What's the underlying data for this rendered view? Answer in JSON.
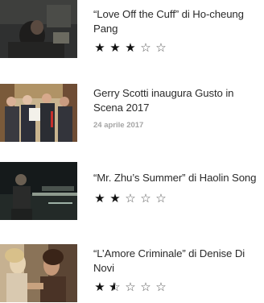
{
  "items": [
    {
      "title": "“Love Off the Cuff” di Ho-cheung Pang",
      "rating": 3,
      "max_rating": 5,
      "thumb_icon": "movie-still-dark-room"
    },
    {
      "title": "Gerry Scotti inaugura Gusto in Scena 2017",
      "date": "24 aprile 2017",
      "thumb_icon": "people-holding-certificate"
    },
    {
      "title": "“Mr. Zhu’s Summer” di Haolin Song",
      "rating": 2,
      "max_rating": 5,
      "thumb_icon": "movie-still-night-street"
    },
    {
      "title": "“L’Amore Criminale” di Denise Di Novi",
      "rating": 1.5,
      "max_rating": 5,
      "thumb_icon": "movie-still-two-women"
    }
  ],
  "glyphs": {
    "star_full": "★",
    "star_empty": "☆"
  }
}
